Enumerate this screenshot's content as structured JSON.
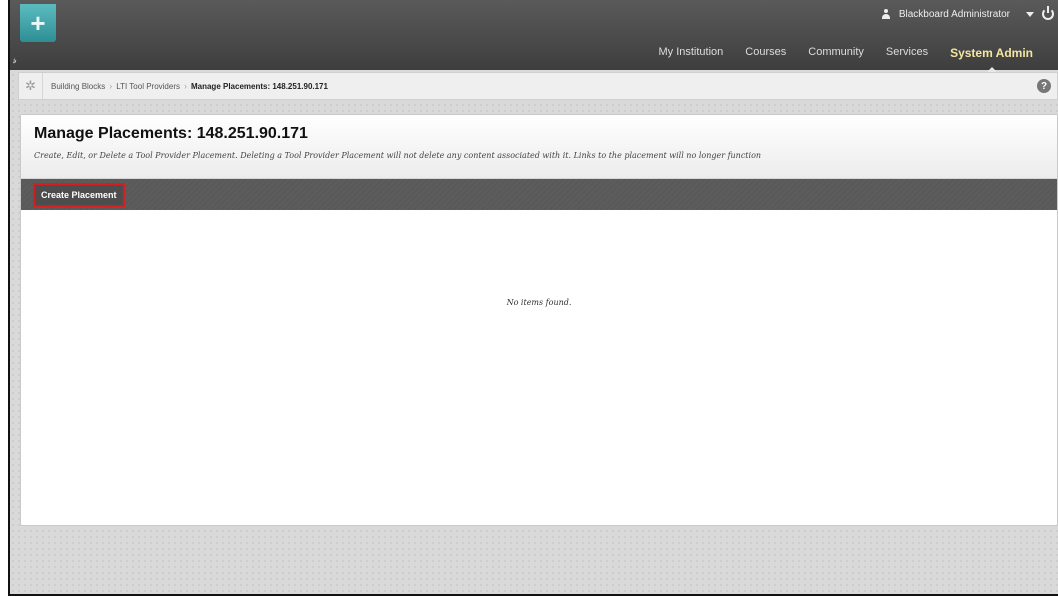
{
  "header": {
    "brand_glyph": "+",
    "user_name": "Blackboard Administrator",
    "nav": [
      {
        "label": "My Institution"
      },
      {
        "label": "Courses"
      },
      {
        "label": "Community"
      },
      {
        "label": "Services"
      },
      {
        "label": "System Admin",
        "active": true
      }
    ]
  },
  "breadcrumb": {
    "items": [
      "Building Blocks",
      "LTI Tool Providers"
    ],
    "current": "Manage Placements: 148.251.90.171",
    "separator": "›"
  },
  "page": {
    "title": "Manage Placements: 148.251.90.171",
    "description": "Create, Edit, or Delete a Tool Provider Placement. Deleting a Tool Provider Placement will not delete any content associated with it. Links to the placement will no longer function"
  },
  "actions": {
    "create_label": "Create Placement"
  },
  "list": {
    "empty_message": "No items found."
  },
  "colors": {
    "accent_active_nav": "#f4e7a1",
    "brand_teal": "#3fa3a9",
    "highlight_border": "#d21f1f"
  }
}
